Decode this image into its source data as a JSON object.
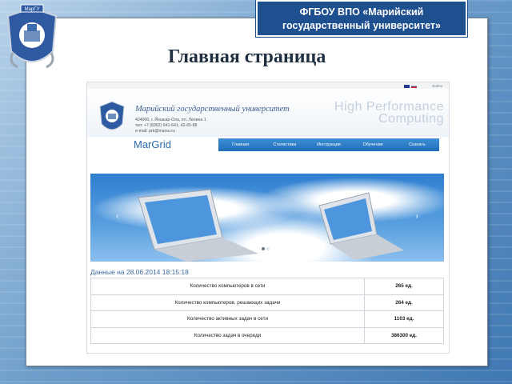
{
  "colors": {
    "banner_bg": "#1e4f8f",
    "nav_bg": "#1f6db8",
    "accent_text": "#3b6ba2"
  },
  "logo": {
    "label": "МарГУ"
  },
  "banner": {
    "line1": "ФГБОУ ВПО «Марийский",
    "line2": "государственный университет»"
  },
  "slide_title": "Главная страница",
  "site": {
    "login": "Войти",
    "university": "Марийский государственный университет",
    "address_line1": "424000, г. Йошкар-Ола, пл. Ленина 1",
    "address_line2": "тел: +7 (8362) 641-641, 42-65-88",
    "address_line3": "e-mail: prk@marsu.ru",
    "hpc_line1": "High Performance",
    "hpc_line2": "Computing",
    "brand": "MarGrid",
    "nav": [
      "Главная",
      "Статистика",
      "Инструкции",
      "Обучение",
      "Скачать"
    ],
    "slider_dots": 2,
    "slider_active": 0,
    "data_title": "Данные на 28.06.2014 18:15:18",
    "stats": [
      {
        "label": "Количество компьютеров в сети",
        "value": "265 ед."
      },
      {
        "label": "Количество компьютеров, решающих задачи",
        "value": "264 ед."
      },
      {
        "label": "Количество активных задач в сети",
        "value": "1103 ед."
      },
      {
        "label": "Количество задач в очереди",
        "value": "386300 ед."
      }
    ]
  }
}
